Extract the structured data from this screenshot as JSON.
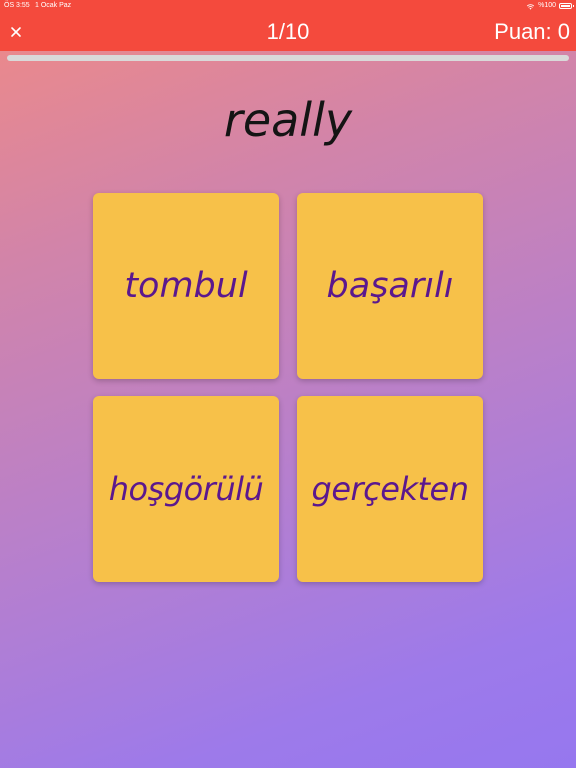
{
  "status_bar": {
    "time": "ÖS 3:55",
    "date": "1 Ocak Paz",
    "battery": "%100",
    "battery_level": 1.0
  },
  "header": {
    "close_icon": "close-icon",
    "progress_label": "1/10",
    "score_label": "Puan: 0"
  },
  "quiz_progress": 0.0,
  "question": {
    "word": "really"
  },
  "answers": [
    {
      "label": "tombul"
    },
    {
      "label": "başarılı"
    },
    {
      "label": "hoşgörülü"
    },
    {
      "label": "gerçekten"
    }
  ],
  "colors": {
    "header": "#f44a3d",
    "card": "#f7c149",
    "card_text": "#5b188e",
    "background_start": "#ef8a86",
    "background_end": "#9677ef"
  }
}
